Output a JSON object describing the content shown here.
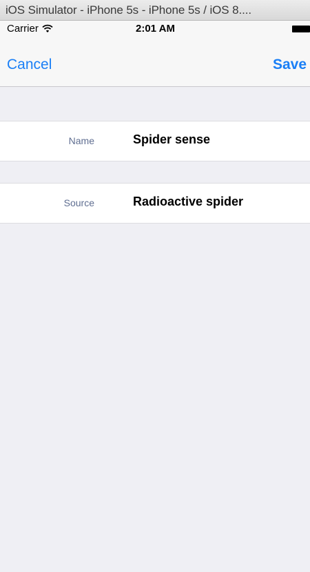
{
  "window": {
    "title": "iOS Simulator - iPhone 5s - iPhone 5s / iOS 8...."
  },
  "status_bar": {
    "carrier": "Carrier",
    "time": "2:01 AM",
    "icons": [
      "wifi-icon",
      "battery-icon"
    ]
  },
  "nav_bar": {
    "cancel_label": "Cancel",
    "save_label": "Save"
  },
  "form": {
    "fields": [
      {
        "label": "Name",
        "value": "Spider sense"
      },
      {
        "label": "Source",
        "value": "Radioactive spider"
      }
    ]
  },
  "colors": {
    "tint": "#1a7ff6",
    "label": "#5f6e91",
    "group_background": "#efeff4",
    "cell_background": "#ffffff"
  }
}
